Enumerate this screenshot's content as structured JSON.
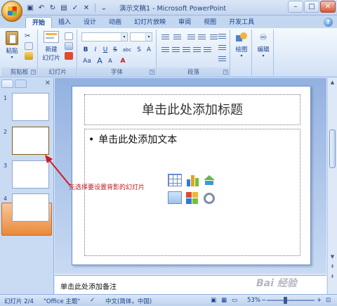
{
  "window": {
    "title": "演示文稿1 - Microsoft PowerPoint"
  },
  "quick_access": {
    "items": [
      "save-icon",
      "undo-icon",
      "redo-icon",
      "print-preview-icon",
      "spelling-icon",
      "close-icon",
      "customize-icon"
    ]
  },
  "ribbon_tabs": [
    "开始",
    "插入",
    "设计",
    "动画",
    "幻灯片放映",
    "审阅",
    "视图",
    "开发工具"
  ],
  "ribbon": {
    "clipboard": {
      "label": "剪贴板",
      "paste": "粘贴"
    },
    "slides": {
      "label": "幻灯片",
      "new_slide_line1": "新建",
      "new_slide_line2": "幻灯片"
    },
    "font": {
      "label": "字体",
      "buttons": [
        "B",
        "I",
        "U",
        "S",
        "abc",
        "S",
        "A",
        "Aa",
        "A",
        "A"
      ]
    },
    "paragraph": {
      "label": "段落"
    },
    "drawing": {
      "label": "绘图"
    },
    "editing": {
      "label": "编辑"
    }
  },
  "slides_pane": {
    "slides": [
      {
        "number": "1"
      },
      {
        "number": "2"
      },
      {
        "number": "3"
      },
      {
        "number": "4"
      }
    ],
    "selected_index": 2
  },
  "slide": {
    "title_placeholder": "单击此处添加标题",
    "body_placeholder": "单击此处添加文本",
    "bullet": "•"
  },
  "annotation": {
    "text": "先选择要设置背影的幻灯片",
    "color": "#c0171d"
  },
  "notes": {
    "placeholder": "单击此处添加备注"
  },
  "status_bar": {
    "slide_info": "幻灯片 2/4",
    "theme": "\"Office 主题\"",
    "language": "中文(简体，中国)",
    "zoom": "53%"
  },
  "watermark": "Bai 经验"
}
